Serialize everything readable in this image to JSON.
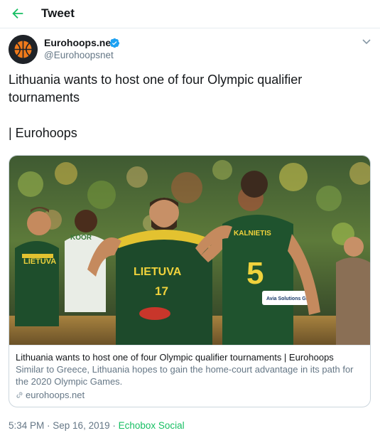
{
  "header": {
    "title": "Tweet",
    "accent_color": "#17bf63"
  },
  "author": {
    "display_name": "Eurohoops.net",
    "handle": "@Eurohoopsnet",
    "verified": true
  },
  "tweet": {
    "text": "Lithuania wants to host one of four Olympic qualifier tournaments\n\n| Eurohoops"
  },
  "card": {
    "jersey_left": "LIETUVA",
    "jersey_center": "LIETUVA",
    "jersey_center_number": "17",
    "jersey_right_name": "KALNIETIS",
    "jersey_right_number": "5",
    "jersey_partial": "KOOR",
    "sponsor": "Avia Solutions Group",
    "title": "Lithuania wants to host one of four Olympic qualifier tournaments | Eurohoops",
    "description": "Similar to Greece, Lithuania hopes to gain the home-court advantage in its path for the 2020 Olympic Games.",
    "domain": "eurohoops.net",
    "link_icon": "link-icon"
  },
  "meta": {
    "time": "5:34 PM",
    "separator": " · ",
    "date": "Sep 16, 2019",
    "source": "Echobox Social"
  }
}
